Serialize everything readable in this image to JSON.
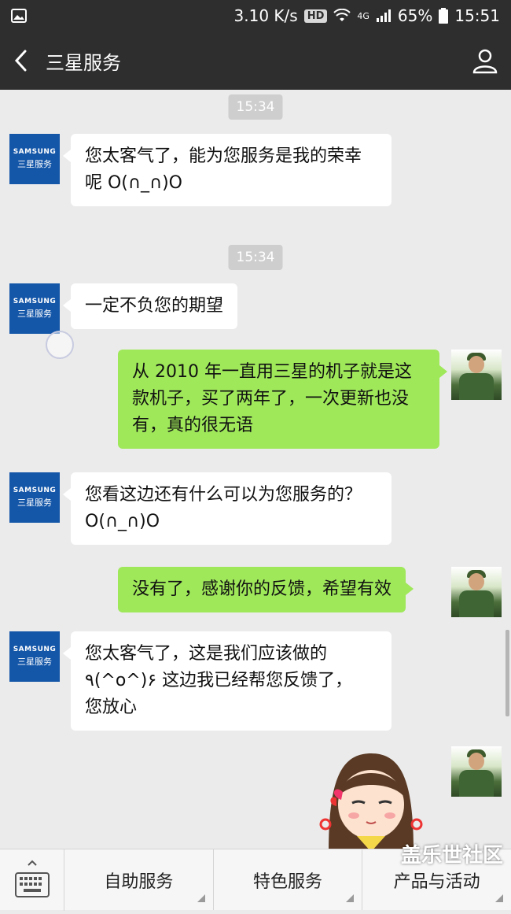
{
  "status_bar": {
    "speed": "3.10 K/s",
    "hd": "HD",
    "network": "4G",
    "battery": "65%",
    "time": "15:51",
    "icons": [
      "image-icon",
      "wifi-icon",
      "signal-icon",
      "battery-icon"
    ]
  },
  "header": {
    "title": "三星服务",
    "back_icon": "back-arrow-icon",
    "profile_icon": "user-profile-icon"
  },
  "samsung_avatar": {
    "brand": "SAMSUNG",
    "label": "三星服务",
    "color": "#1456a8"
  },
  "messages": [
    {
      "type": "time",
      "text": "15:34"
    },
    {
      "type": "incoming",
      "lines": [
        "您太客气了，能为您服务是我的荣幸",
        "呢 O(∩_∩)O"
      ]
    },
    {
      "type": "time",
      "text": "15:34"
    },
    {
      "type": "incoming",
      "lines": [
        "一定不负您的期望"
      ]
    },
    {
      "type": "outgoing",
      "lines": [
        "从 2010 年一直用三星的机子就是这",
        "款机子，买了两年了，一次更新也没",
        "有，真的很无语"
      ]
    },
    {
      "type": "incoming",
      "lines": [
        "您看这边还有什么可以为您服务的？",
        "O(∩_∩)O"
      ]
    },
    {
      "type": "outgoing",
      "lines": [
        "没有了，感谢你的反馈，希望有效"
      ]
    },
    {
      "type": "incoming",
      "lines": [
        "您太客气了，这是我们应该做的",
        "٩(^o^)۶  这边我已经帮您反馈了，",
        "您放心"
      ]
    },
    {
      "type": "outgoing-sticker",
      "sticker": "girl-sticker"
    }
  ],
  "bottom_bar": {
    "keyboard_icon": "keyboard-icon",
    "menu": [
      "自助服务",
      "特色服务",
      "产品与活动"
    ]
  },
  "watermark": {
    "line1": "盖乐世社区",
    "line2": "@"
  },
  "colors": {
    "nav": "#2e2e2e",
    "chat_bg": "#ebebeb",
    "outgoing": "#9fe85a",
    "incoming": "#ffffff"
  }
}
